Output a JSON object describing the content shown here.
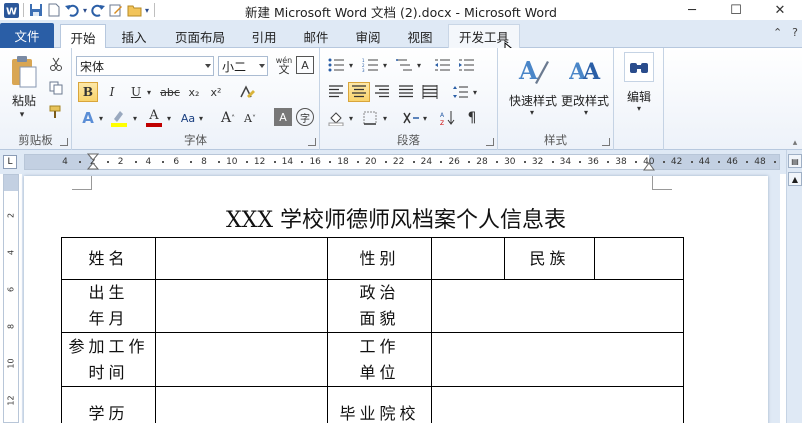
{
  "window": {
    "title": "新建 Microsoft Word 文档 (2).docx  -  Microsoft Word",
    "minimize": "─",
    "maximize": "☐",
    "close": "✕"
  },
  "qat": {
    "icons": [
      "word-app-icon",
      "save-icon",
      "new-doc-icon",
      "undo-icon",
      "redo-icon",
      "edit-icon",
      "open-folder-icon"
    ]
  },
  "tabs": {
    "file": "文件",
    "items": [
      {
        "label": "开始",
        "state": "active"
      },
      {
        "label": "插入",
        "state": ""
      },
      {
        "label": "页面布局",
        "state": ""
      },
      {
        "label": "引用",
        "state": ""
      },
      {
        "label": "邮件",
        "state": ""
      },
      {
        "label": "审阅",
        "state": ""
      },
      {
        "label": "视图",
        "state": ""
      },
      {
        "label": "开发工具",
        "state": "hover"
      }
    ]
  },
  "ribbon": {
    "clipboard": {
      "label": "剪贴板",
      "paste": "粘贴"
    },
    "font": {
      "label": "字体",
      "font_name": "宋体",
      "font_size": "小二",
      "pinyin": "wén",
      "bold": "B",
      "italic": "I",
      "underline": "U",
      "strike": "abc",
      "subscript": "x₂",
      "superscript": "x²",
      "grow": "A",
      "shrink": "A",
      "clear": "A"
    },
    "paragraph": {
      "label": "段落"
    },
    "styles": {
      "label": "样式",
      "quick": "快速样式",
      "change": "更改样式"
    },
    "editing": {
      "label": "编辑"
    }
  },
  "ruler": {
    "ticks": [
      "4",
      "2",
      "2",
      "4",
      "6",
      "8",
      "10",
      "12",
      "14",
      "16",
      "18",
      "20",
      "22",
      "24",
      "26",
      "28",
      "30",
      "32",
      "34",
      "36",
      "38",
      "40",
      "42",
      "44",
      "46",
      "48"
    ]
  },
  "vruler": {
    "ticks": [
      "2",
      "4",
      "6",
      "8",
      "10",
      "12"
    ]
  },
  "document": {
    "heading": "XXX 学校师德师风档案个人信息表",
    "table": {
      "name": "姓名",
      "gender": "性别",
      "ethnicity": "民族",
      "birth_1": "出生",
      "birth_2": "年月",
      "political_1": "政治",
      "political_2": "面貌",
      "work_start_1": "参加工作",
      "work_start_2": "时间",
      "employer_1": "工作",
      "employer_2": "单位",
      "education": "学历",
      "school": "毕业院校"
    }
  }
}
